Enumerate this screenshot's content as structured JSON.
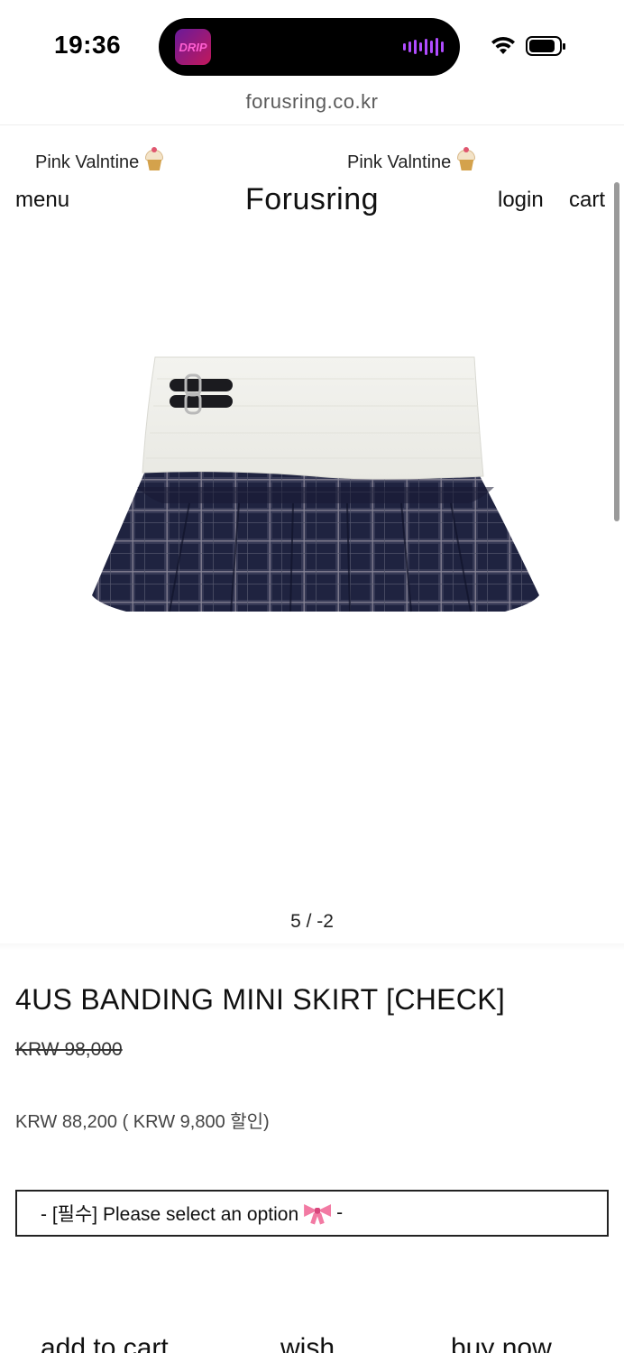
{
  "status_bar": {
    "time": "19:36",
    "app_badge": "DRIP"
  },
  "browser": {
    "url": "forusring.co.kr"
  },
  "marquee": {
    "items": [
      "Pink Valntine",
      "Pink Valntine"
    ]
  },
  "header": {
    "menu_label": "menu",
    "logo": "Forusring",
    "login_label": "login",
    "cart_label": "cart"
  },
  "gallery": {
    "counter": "5 / -2"
  },
  "product": {
    "title": "4US BANDING MINI SKIRT [CHECK]",
    "original_price": "KRW 98,000",
    "sale_price": "KRW 88,200 ( KRW 9,800 할인)"
  },
  "option": {
    "text_before": "- [필수] Please select an option",
    "text_after": "-"
  },
  "actions": {
    "add_to_cart": "add to cart",
    "wish": "wish",
    "buy_now": "buy now"
  }
}
